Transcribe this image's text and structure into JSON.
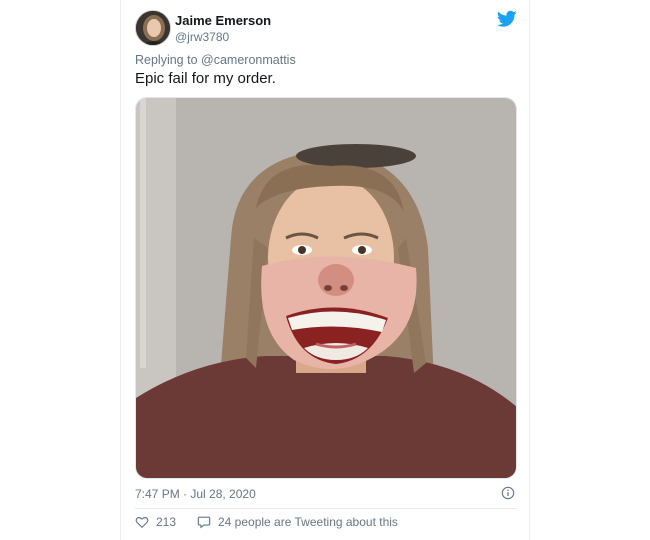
{
  "tweet": {
    "author_name": "Jaime Emerson",
    "author_handle": "@jrw3780",
    "reply_prefix": "Replying to",
    "reply_to": "@cameronmattis",
    "text": "Epic fail for my order.",
    "timestamp": "7:47 PM · Jul 28, 2020",
    "likes": "213",
    "tweeting_text": "24 people are Tweeting about this"
  },
  "icons": {
    "brand": "twitter-bird-icon",
    "info": "info-icon",
    "like": "heart-icon",
    "reply": "speech-bubble-icon"
  },
  "colors": {
    "brand_blue": "#1da1f2",
    "text_primary": "#14171a",
    "text_secondary": "#657786",
    "divider": "#e6ecf0"
  }
}
